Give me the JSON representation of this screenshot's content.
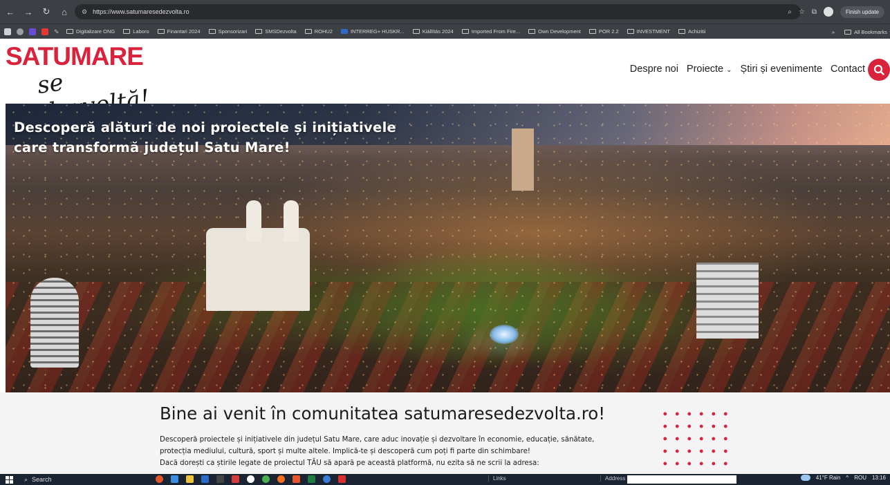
{
  "browser": {
    "url": "https://www.satumaresedezvolta.ro",
    "finish_update_label": "Finish update",
    "bookmarks": [
      "Digitalizare ONG",
      "Laboro",
      "Finantari 2024",
      "Sponsorizari",
      "SMSDezvolta",
      "ROHU2",
      "INTERREG+ HUSKR...",
      "Kiállítás 2024",
      "Imported From Fire...",
      "Own Development",
      "POR 2.2",
      "INVESTMENT",
      "Achizitii"
    ],
    "all_bookmarks_label": "All Bookmarks"
  },
  "site": {
    "logo_top": "SATUMARE",
    "logo_bottom": "se dezvoltă!",
    "nav": [
      "Despre noi",
      "Proiecte",
      "Știri și evenimente",
      "Contact"
    ],
    "hero_title_line1": "Descoperă alături de noi proiectele și inițiativele",
    "hero_title_line2": "care transformă județul Satu Mare!",
    "welcome_title": "Bine ai venit în comunitatea satumaresedezvolta.ro!",
    "welcome_line1": "Descoperă proiectele și inițiativele din județul Satu Mare, care aduc inovație și dezvoltare în economie, educație, sănătate,",
    "welcome_line2": "protecția mediului, cultură, sport și multe altele. Implică-te și descoperă cum poți fi parte din schimbare!",
    "welcome_line3": "Dacă dorești ca știrile legate de proiectul TĂU să apară pe această platformă, nu ezita să ne scrii la adresa:"
  },
  "taskbar": {
    "search_placeholder": "Search",
    "links_label": "Links",
    "address_label": "Address",
    "weather": "41°F  Rain",
    "language": "ROU",
    "time": "13:16"
  },
  "colors": {
    "brand_red": "#d9223c",
    "chrome_bg": "#3c3f44",
    "taskbar_bg": "#1b2433"
  }
}
